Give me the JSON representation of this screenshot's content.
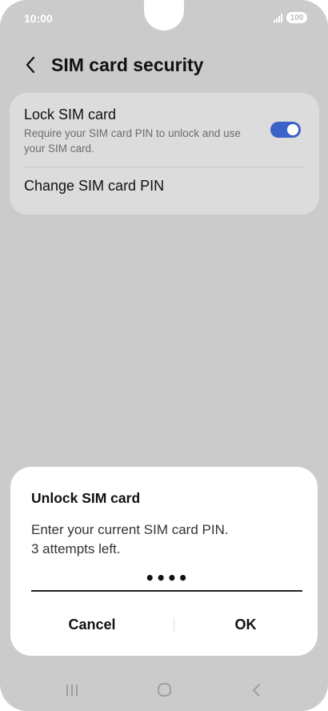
{
  "status_bar": {
    "time": "10:00",
    "battery": "100"
  },
  "header": {
    "title": "SIM card security",
    "back_icon": "chevron-left-icon"
  },
  "settings": {
    "lock_sim": {
      "title": "Lock SIM card",
      "description": "Require your SIM card PIN to unlock and use your SIM card.",
      "enabled": true
    },
    "change_pin": {
      "title": "Change SIM card PIN"
    }
  },
  "dialog": {
    "title": "Unlock SIM card",
    "message_line1": "Enter your current SIM card PIN.",
    "message_line2": "3 attempts left.",
    "pin_value": "••••",
    "cancel_label": "Cancel",
    "ok_label": "OK"
  },
  "nav": {
    "recents_icon": "recents-icon",
    "home_icon": "home-icon",
    "back_icon": "back-icon"
  },
  "colors": {
    "accent": "#3a62c8",
    "background": "#cbcbcb",
    "card": "#dcdcdc"
  }
}
